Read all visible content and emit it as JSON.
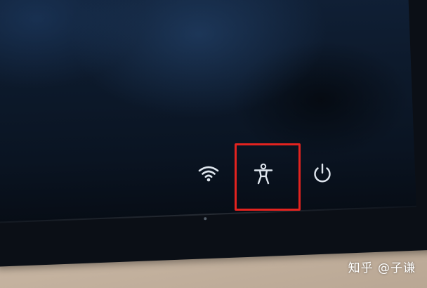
{
  "lockscreen": {
    "icons": {
      "network": "wifi-icon",
      "accessibility": "accessibility-icon",
      "power": "power-icon"
    },
    "highlight_color": "#e3231f",
    "icon_color": "#dfe6ee"
  },
  "watermark": {
    "text": "知乎 @子谦"
  }
}
